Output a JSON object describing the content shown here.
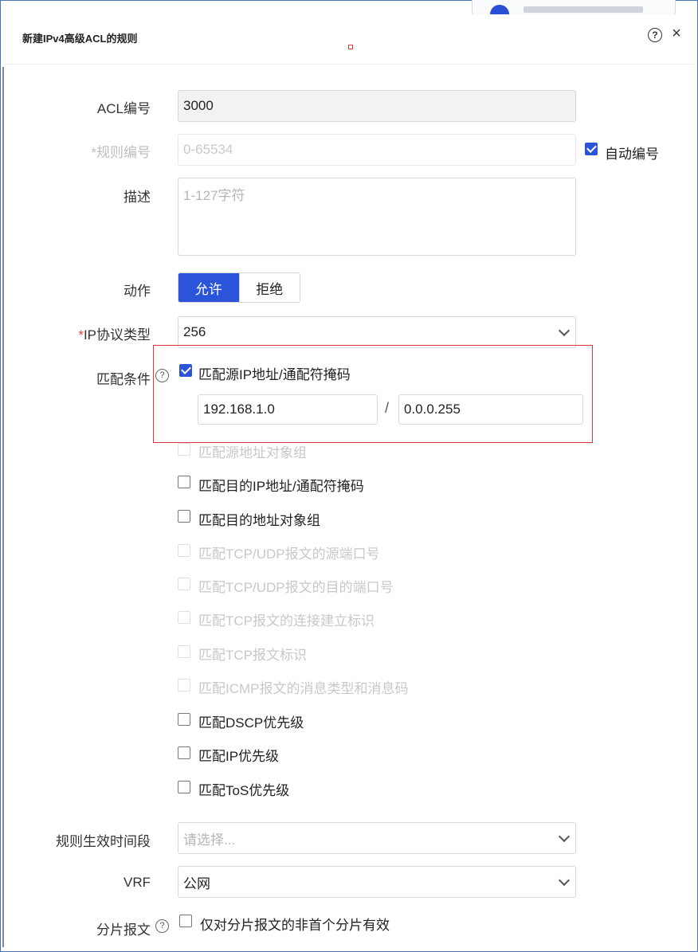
{
  "dialog": {
    "title": "新建IPv4高级ACL的规则",
    "help_icon": "?",
    "close_icon": "×"
  },
  "form": {
    "acl_number": {
      "label": "ACL编号",
      "value": "3000"
    },
    "rule_number": {
      "required": "*",
      "label": "规则编号",
      "placeholder": "0-65534",
      "auto_label": "自动编号",
      "auto_checked": true
    },
    "description": {
      "label": "描述",
      "placeholder": "1-127字符"
    },
    "action": {
      "label": "动作",
      "options": [
        "允许",
        "拒绝"
      ],
      "selected": "允许"
    },
    "ip_protocol": {
      "required": "*",
      "label": "IP协议类型",
      "value": "256"
    },
    "match": {
      "label": "匹配条件",
      "help_icon": "?",
      "conditions": [
        {
          "label": "匹配源IP地址/通配符掩码",
          "checked": true,
          "enabled": true
        },
        {
          "label": "匹配源地址对象组",
          "checked": false,
          "enabled": false
        },
        {
          "label": "匹配目的IP地址/通配符掩码",
          "checked": false,
          "enabled": true
        },
        {
          "label": "匹配目的地址对象组",
          "checked": false,
          "enabled": true
        },
        {
          "label": "匹配TCP/UDP报文的源端口号",
          "checked": false,
          "enabled": false
        },
        {
          "label": "匹配TCP/UDP报文的目的端口号",
          "checked": false,
          "enabled": false
        },
        {
          "label": "匹配TCP报文的连接建立标识",
          "checked": false,
          "enabled": false
        },
        {
          "label": "匹配TCP报文标识",
          "checked": false,
          "enabled": false
        },
        {
          "label": "匹配ICMP报文的消息类型和消息码",
          "checked": false,
          "enabled": false
        },
        {
          "label": "匹配DSCP优先级",
          "checked": false,
          "enabled": true
        },
        {
          "label": "匹配IP优先级",
          "checked": false,
          "enabled": true
        },
        {
          "label": "匹配ToS优先级",
          "checked": false,
          "enabled": true
        }
      ],
      "source_ip": "192.168.1.0",
      "separator": "/",
      "wildcard": "0.0.0.255"
    },
    "time_range": {
      "label": "规则生效时间段",
      "placeholder": "请选择..."
    },
    "vrf": {
      "label": "VRF",
      "value": "公网"
    },
    "fragment": {
      "label": "分片报文",
      "help_icon": "?",
      "option": "仅对分片报文的非首个分片有效",
      "checked": false
    }
  },
  "colors": {
    "primary": "#2b54d9",
    "highlight": "#e0353a",
    "required": "#e04545"
  }
}
